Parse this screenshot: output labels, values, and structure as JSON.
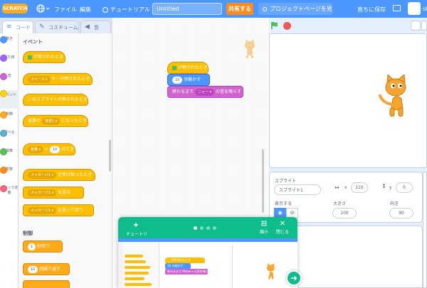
{
  "menubar": {
    "logo": "SCRATCH",
    "file": "ファイル",
    "edit": "編集",
    "tutorials": "チュートリアル",
    "project_title": "Untitled",
    "share": "共有する",
    "project_page": "プロジェクトページを見る",
    "save_now": "直ちに保存",
    "username": "sh"
  },
  "tabs": {
    "code": "コード",
    "costumes": "コスチューム",
    "sounds": "音"
  },
  "categories": [
    {
      "label": "動き",
      "color": "#4c97ff"
    },
    {
      "label": "見た目",
      "color": "#9966ff"
    },
    {
      "label": "音",
      "color": "#cf63cf"
    },
    {
      "label": "イベント",
      "color": "#ffd500"
    },
    {
      "label": "制御",
      "color": "#ffab19"
    },
    {
      "label": "調べる",
      "color": "#5cb1d6"
    },
    {
      "label": "演算",
      "color": "#59c059"
    },
    {
      "label": "変数",
      "color": "#ff8c1a"
    },
    {
      "label": "ブロック定義",
      "color": "#ff6680"
    }
  ],
  "palette": {
    "events_heading": "イベント",
    "flag_clicked": "が押されたとき",
    "key_dropdown": "スペース ▾",
    "key_pressed": "キーが押されたとき",
    "sprite_clicked": "このスプライトが押されたとき",
    "backdrop_prefix": "背景が",
    "backdrop_dropdown": "背景1 ▾",
    "backdrop_suffix": "になったとき",
    "volume_dropdown": "音量 ▾",
    "gt": ">",
    "volume_value": "10",
    "when_suffix": "のとき",
    "message_dropdown": "メッセージ1 ▾",
    "receive_suffix": "を受け取ったとき",
    "broadcast_suffix": "を送る",
    "broadcast_wait_suffix": "を送って待つ",
    "control_heading": "制御",
    "wait_value": "1",
    "wait_suffix": "秒待つ",
    "repeat_value": "10",
    "repeat_suffix": "回繰り返す"
  },
  "script": {
    "flag_clicked": "が押されたとき",
    "move_value": "10",
    "move_suffix": "歩動かす",
    "sound_prefix": "終わるまで",
    "sound_dropdown": "ニャー ▾",
    "sound_suffix": "の音を鳴らす"
  },
  "sprite_info": {
    "sprite_label": "スプライト",
    "sprite_name": "スプライト1",
    "x_label": "x",
    "x_value": "110",
    "y_label": "y",
    "y_value": "0",
    "show_label": "表示する",
    "size_label": "大きさ",
    "size_value": "100",
    "direction_label": "向き",
    "direction_value": "90"
  },
  "tutorial": {
    "title": "チュートリアル",
    "shrink": "縮小",
    "close": "閉じる",
    "step_dots": 4,
    "active_dot": 0,
    "thumb_script_flag": "が押されたとき",
    "thumb_move_value": "10",
    "thumb_move_suffix": "歩動かす",
    "thumb_sound_prefix": "終わるまで",
    "thumb_sound_dropdown": "Meow ▾",
    "thumb_sound_suffix": "の音を鳴らす"
  }
}
